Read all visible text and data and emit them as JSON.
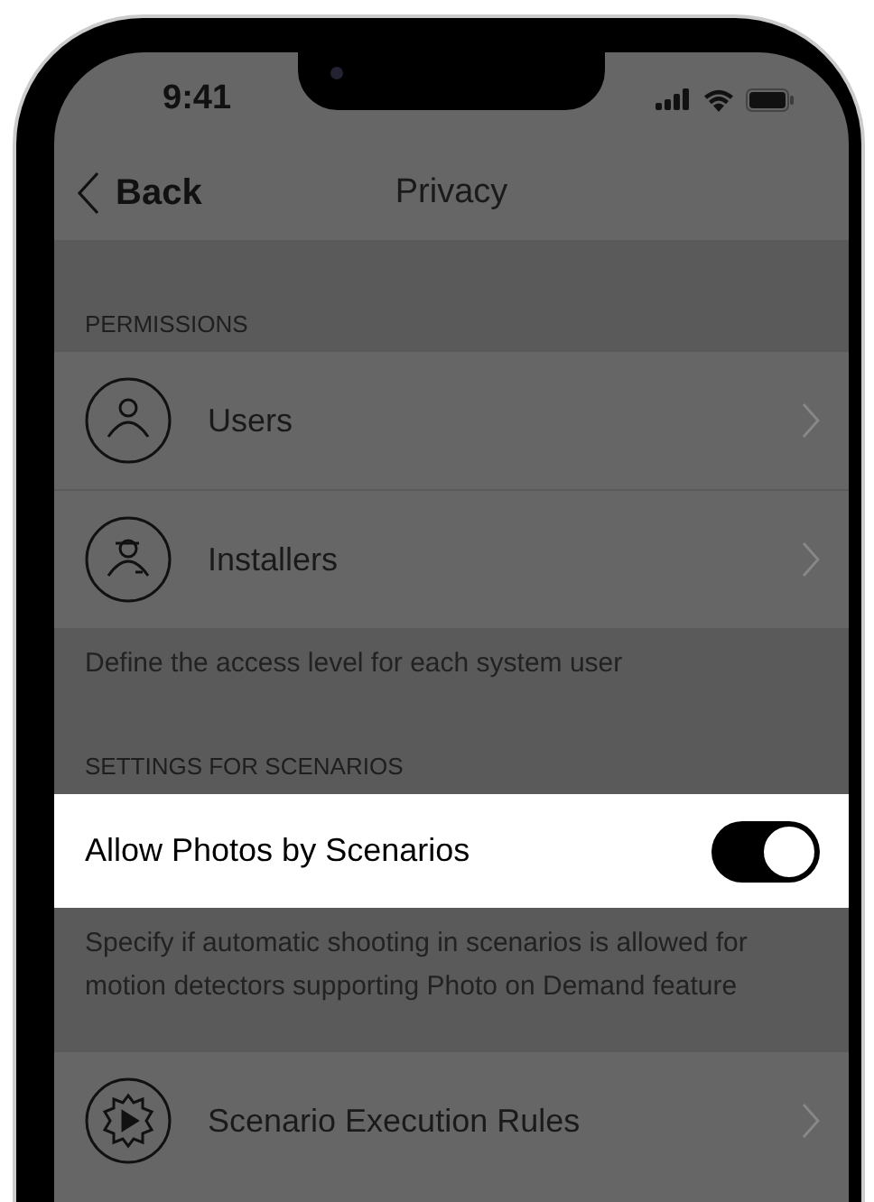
{
  "status_bar": {
    "time": "9:41"
  },
  "nav": {
    "back": "Back",
    "title": "Privacy"
  },
  "sections": [
    {
      "header": "PERMISSIONS",
      "footer": "Define the access level for each system user",
      "items": [
        {
          "kind": "link",
          "label": "Users",
          "highlighted": false
        },
        {
          "kind": "link",
          "label": "Installers",
          "highlighted": false
        }
      ]
    },
    {
      "header": "SETTINGS FOR SCENARIOS",
      "footer": "Specify if automatic shooting in scenarios is allowed for motion detectors supporting Photo on Demand feature",
      "items": [
        {
          "kind": "toggle",
          "label": "Allow Photos by Scenarios",
          "on": true,
          "highlighted": true
        }
      ]
    },
    {
      "items": [
        {
          "kind": "link",
          "label": "Scenario Execution Rules",
          "highlighted": false
        }
      ]
    }
  ]
}
